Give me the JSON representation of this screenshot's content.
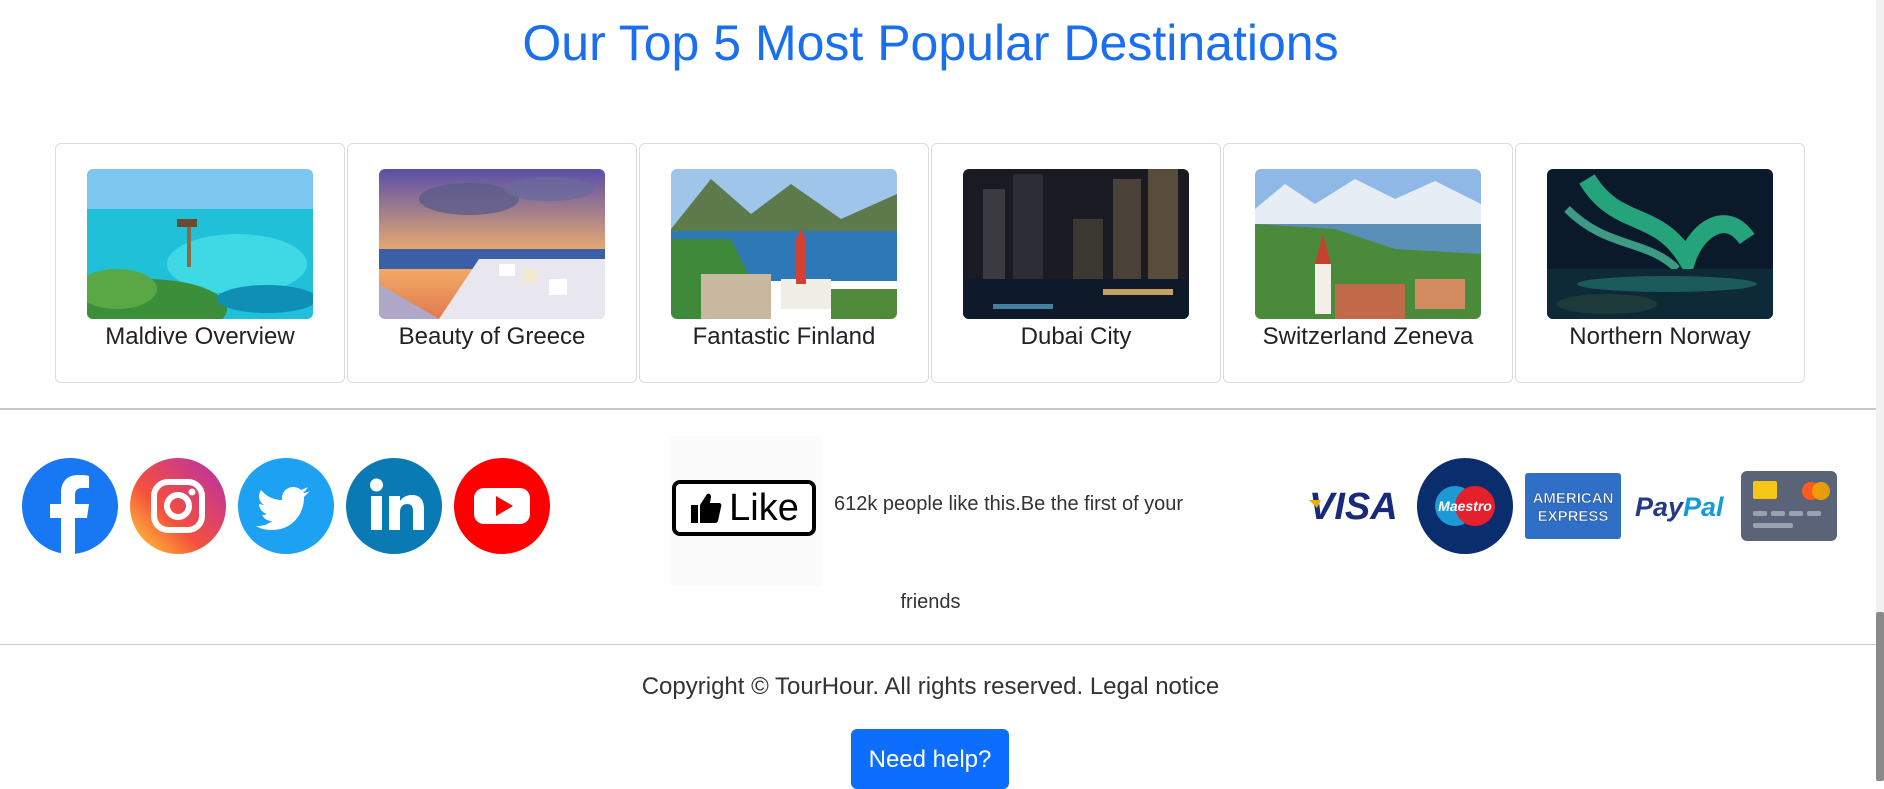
{
  "section_title": "Our Top 5 Most Popular Destinations",
  "destinations": [
    {
      "label": "Maldive Overview"
    },
    {
      "label": "Beauty of Greece"
    },
    {
      "label": "Fantastic Finland"
    },
    {
      "label": "Dubai City"
    },
    {
      "label": "Switzerland Zeneva"
    },
    {
      "label": "Northern Norway"
    }
  ],
  "social_icons": [
    "facebook-icon",
    "instagram-icon",
    "twitter-icon",
    "linkedin-icon",
    "youtube-icon"
  ],
  "like": {
    "button_label": "Like",
    "text_line1": "612k people like this.Be the first of your",
    "text_line2": "friends"
  },
  "payments": [
    "VISA",
    "Maestro",
    "AMERICAN EXPRESS",
    "PayPal"
  ],
  "footer": {
    "copyright": "Copyright © TourHour. All rights reserved. Legal notice",
    "help_button": "Need help?"
  },
  "colors": {
    "accent": "#1a6ef0",
    "button": "#0d6efd",
    "facebook": "#1877f2",
    "twitter": "#1da1f2",
    "linkedin": "#0a7ab5",
    "youtube": "#ff0000"
  }
}
